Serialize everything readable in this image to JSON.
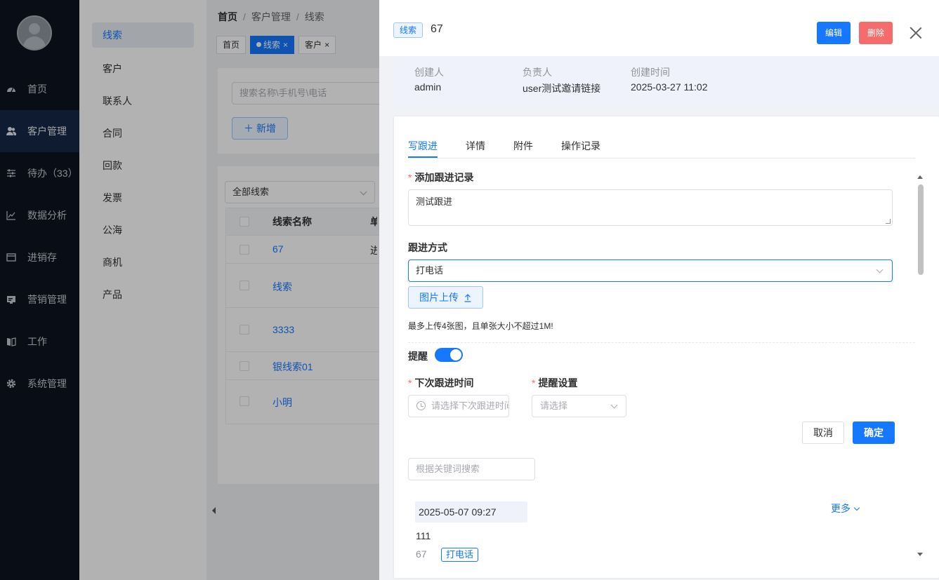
{
  "sidebar": {
    "items": [
      {
        "label": "首页",
        "icon": "dashboard-icon"
      },
      {
        "label": "客户管理",
        "icon": "users-icon"
      },
      {
        "label": "待办（33）",
        "icon": "sliders-icon"
      },
      {
        "label": "数据分析",
        "icon": "chart-icon"
      },
      {
        "label": "进销存",
        "icon": "window-icon"
      },
      {
        "label": "营销管理",
        "icon": "billboard-icon"
      },
      {
        "label": "工作",
        "icon": "book-icon"
      },
      {
        "label": "系统管理",
        "icon": "gear-icon"
      }
    ]
  },
  "submenu": {
    "items": [
      "线索",
      "客户",
      "联系人",
      "合同",
      "回款",
      "发票",
      "公海",
      "商机",
      "产品"
    ]
  },
  "breadcrumb": [
    "首页",
    "客户管理",
    "线索"
  ],
  "tags": [
    "首页",
    "线索",
    "客户"
  ],
  "list": {
    "search_placeholder": "搜索名称\\手机号\\电话",
    "add_label": "新增",
    "filter_value": "全部线索",
    "column_name": "线索名称",
    "column_second_partial": "单",
    "rows": [
      "67",
      "线索",
      "3333",
      "银线索01",
      "小明"
    ],
    "row_peek": "进"
  },
  "drawer": {
    "tag": "线索",
    "title": "67",
    "edit_label": "编辑",
    "delete_label": "删除",
    "info": [
      {
        "key": "创建人",
        "value": "admin"
      },
      {
        "key": "负责人",
        "value": "user测试邀请链接"
      },
      {
        "key": "创建时间",
        "value": "2025-03-27 11:02"
      }
    ],
    "tabs": [
      "写跟进",
      "详情",
      "附件",
      "操作记录"
    ],
    "form": {
      "record_label": "添加跟进记录",
      "record_value": "测试跟进",
      "method_label": "跟进方式",
      "method_value": "打电话",
      "upload_label": "图片上传",
      "upload_hint": "最多上传4张图，且单张大小不超过1M!",
      "remind_label": "提醒",
      "next_time_label": "下次跟进时间",
      "next_time_placeholder": "请选择下次跟进时间",
      "remind_setting_label": "提醒设置",
      "remind_setting_placeholder": "请选择",
      "cancel_label": "取消",
      "ok_label": "确定",
      "keyword_placeholder": "根据关键词搜索"
    },
    "record": {
      "date": "2025-05-07 09:27",
      "more_label": "更多",
      "text": "111",
      "id": "67",
      "method_tag": "打电话"
    }
  },
  "colors": {
    "primary": "#1677ff",
    "danger": "#f56c6c",
    "sidebar_bg": "#0c1420"
  }
}
